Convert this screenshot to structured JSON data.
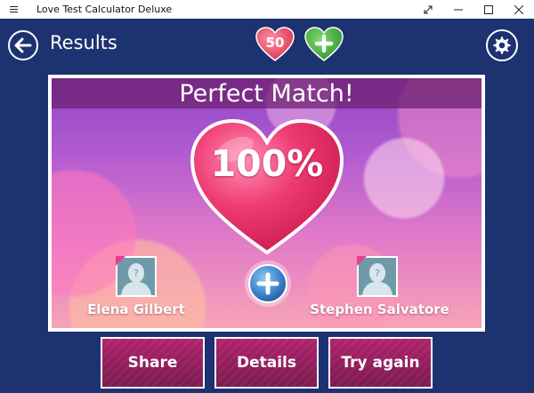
{
  "window": {
    "title": "Love Test Calculator Deluxe"
  },
  "header": {
    "title": "Results",
    "coins": "50"
  },
  "result": {
    "title": "Perfect Match!",
    "percent": "100%",
    "person_left": "Elena Gilbert",
    "person_right": "Stephen Salvatore"
  },
  "actions": {
    "share": "Share",
    "details": "Details",
    "try_again": "Try again"
  },
  "colors": {
    "background": "#1d3270",
    "heart": "#e8245f",
    "coin_badge": "#e8476b",
    "add_badge": "#3fa83a",
    "button": "#9d1f63",
    "card_gradient_top": "#8e45c4",
    "card_gradient_bottom": "#f6a3b8"
  },
  "icons": [
    "menu-icon",
    "expand-icon",
    "minimize-icon",
    "maximize-icon",
    "close-icon",
    "back-arrow-icon",
    "heart-coin-icon",
    "add-heart-icon",
    "gear-icon",
    "avatar-placeholder-icon",
    "plus-circle-icon"
  ]
}
